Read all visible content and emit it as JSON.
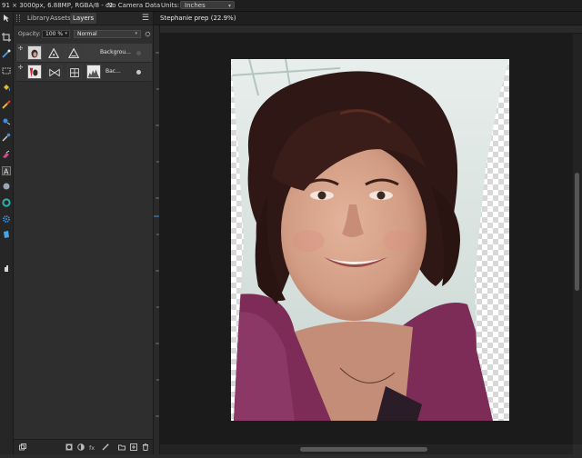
{
  "context_bar": {
    "image_info": "91 × 3000px, 6.88MP, RGBA/8 - c2",
    "camera": "No Camera Data",
    "units_label": "Units:",
    "units_value": "Inches"
  },
  "tools": [
    "move-tool-icon",
    "crop-tool-icon",
    "selection-brush-icon",
    "marquee-icon",
    "flood-fill-icon",
    "paint-brush-icon",
    "clone-brush-icon",
    "eyedropper-icon",
    "eraser-icon",
    "text-tool-icon",
    "dodge-icon",
    "color-wheel-icon",
    "settings-icon",
    "notes-icon",
    "hand-icon"
  ],
  "studio": {
    "tabs": [
      "Library",
      "Assets",
      "Layers"
    ],
    "active_tab": "Layers",
    "opacity_label": "Opacity:",
    "opacity_value": "100 %",
    "blend_mode": "Normal",
    "layers": [
      {
        "name": "Backgrou...",
        "selected": true,
        "visible": false
      },
      {
        "name": "Bac...",
        "selected": false,
        "visible": true
      }
    ]
  },
  "document": {
    "tab_title": "Stephanie prep (22.9%)"
  },
  "colors": {
    "accent_blue": "#3d8fe0",
    "panel_bg": "#2e2e2e",
    "canvas_bg": "#1b1b1b",
    "shirt": "#7c2c57",
    "hair": "#2e1714",
    "skin": "#d7a48c"
  }
}
